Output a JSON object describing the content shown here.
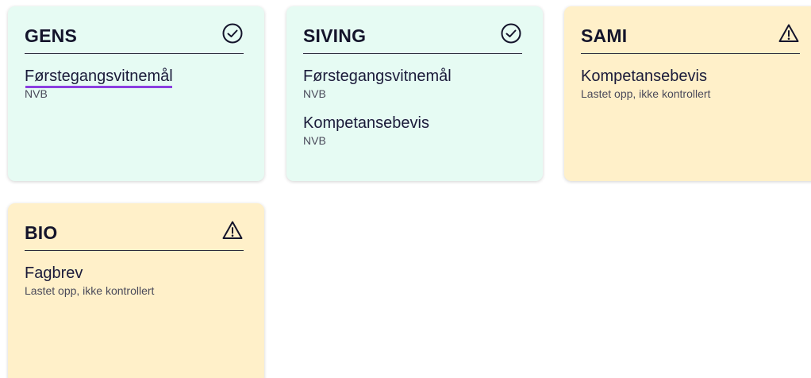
{
  "cards": [
    {
      "title": "GENS",
      "status": "approved",
      "icon": "check-circle-icon",
      "items": [
        {
          "title": "Førstegangsvitnemål",
          "status": "NVB"
        }
      ]
    },
    {
      "title": "SIVING",
      "status": "approved",
      "icon": "check-circle-icon",
      "items": [
        {
          "title": "Førstegangsvitnemål",
          "status": "NVB"
        },
        {
          "title": "Kompetansebevis",
          "status": "NVB"
        }
      ]
    },
    {
      "title": "SAMI",
      "status": "warning",
      "icon": "warning-triangle-icon",
      "items": [
        {
          "title": "Kompetansebevis",
          "status": "Lastet opp, ikke kontrollert"
        }
      ]
    },
    {
      "title": "BIO",
      "status": "warning",
      "icon": "warning-triangle-icon",
      "items": [
        {
          "title": "Fagbrev",
          "status": "Lastet opp, ikke kontrollert"
        }
      ]
    }
  ],
  "colors": {
    "approved_bg": "#e6fbf3",
    "warning_bg": "#fff0c9",
    "focus_underline": "#8b3fe0",
    "text": "#1b1b3a"
  }
}
